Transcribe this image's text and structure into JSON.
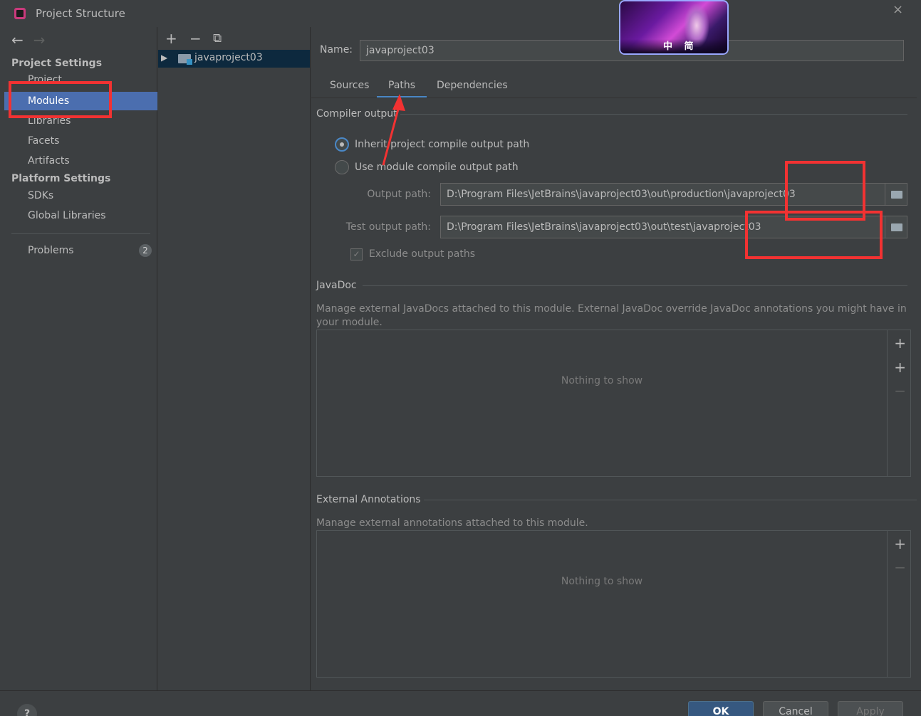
{
  "window": {
    "title": "Project Structure",
    "close": "×"
  },
  "nav": {
    "back": "←",
    "forward": "→"
  },
  "sidebar": {
    "project_settings": "Project Settings",
    "project_settings_items": [
      "Project",
      "Modules",
      "Libraries",
      "Facets",
      "Artifacts"
    ],
    "platform_settings": "Platform Settings",
    "platform_settings_items": [
      "SDKs",
      "Global Libraries"
    ],
    "problems": {
      "label": "Problems",
      "count": "2"
    },
    "selected": "Modules"
  },
  "tree_toolbar": {
    "add": "+",
    "remove": "−",
    "copy": "⧉"
  },
  "tree": {
    "module": "javaproject03"
  },
  "main": {
    "name_label": "Name:",
    "name_value": "javaproject03",
    "tabs": [
      "Sources",
      "Paths",
      "Dependencies"
    ],
    "active_tab": "Paths",
    "compiler_output": {
      "title": "Compiler output",
      "inherit_label": "Inherit project compile output path",
      "use_module_label": "Use module compile output path",
      "output_path_label": "Output path:",
      "output_path_value": "D:\\Program Files\\JetBrains\\javaproject03\\out\\production\\javaproject03",
      "test_output_path_label": "Test output path:",
      "test_output_path_value": "D:\\Program Files\\JetBrains\\javaproject03\\out\\test\\javaproject03",
      "exclude_label": "Exclude output paths",
      "exclude_checked": "✓"
    },
    "javadoc": {
      "title": "JavaDoc",
      "description": "Manage external JavaDocs attached to this module. External JavaDoc override JavaDoc annotations you might have in your module.",
      "empty": "Nothing to show",
      "tools": [
        "+",
        "+",
        "−"
      ]
    },
    "external_annotations": {
      "title": "External Annotations",
      "description": "Manage external annotations attached to this module.",
      "empty": "Nothing to show",
      "tools": [
        "+",
        "−"
      ]
    }
  },
  "footer": {
    "help": "?",
    "ok": "OK",
    "cancel": "Cancel",
    "apply": "Apply"
  },
  "overlay": {
    "thumbnail_text": "中 简"
  },
  "colors": {
    "accent": "#4a88c7",
    "selection": "#4b6eaf",
    "annotation": "#f23232"
  }
}
